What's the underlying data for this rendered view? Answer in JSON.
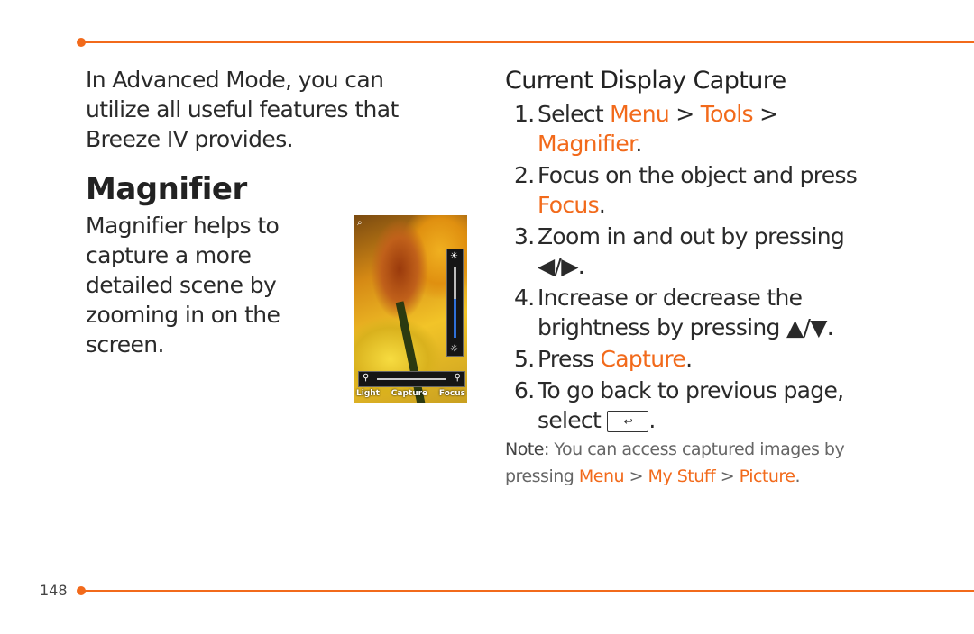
{
  "colors": {
    "accent": "#f26a1b",
    "text": "#2a2a2a"
  },
  "intro": "In Advanced Mode, you can utilize all useful features that Breeze IV provides.",
  "magnifier": {
    "title": "Magnifier",
    "description": "Magnifier helps to capture a more detailed scene by zooming in on the screen.",
    "screen": {
      "softkeys": {
        "left": "Light",
        "center": "Capture",
        "right": "Focus"
      },
      "icons": {
        "top_left": "magnifier-mode-icon",
        "brightness_high": "sun-icon",
        "brightness_low": "sun-outline-icon",
        "zoom_out": "zoom-out-icon",
        "zoom_in": "zoom-in-icon"
      },
      "brightness_level": 0.55
    }
  },
  "section": {
    "title": "Current Display Capture",
    "steps": [
      {
        "num": "1.",
        "text": "Select ",
        "path": [
          "Menu",
          "Tools",
          "Magnifier"
        ],
        "end": "."
      },
      {
        "num": "2.",
        "text": "Focus on the object and press ",
        "highlight": "Focus",
        "end": "."
      },
      {
        "num": "3.",
        "text": "Zoom in and out by pressing ",
        "keys": "◀/▶",
        "end": "."
      },
      {
        "num": "4.",
        "text": "Increase or decrease the brightness by pressing ",
        "keys": "▲/▼",
        "end": "."
      },
      {
        "num": "5.",
        "text": "Press ",
        "highlight": "Capture",
        "end": "."
      },
      {
        "num": "6.",
        "text": "To go back to previous page, select ",
        "key_icon": "↩",
        "end": "."
      }
    ],
    "note": {
      "label": "Note:",
      "text": " You can access captured images by pressing ",
      "path": [
        "Menu",
        "My Stuff",
        "Picture"
      ],
      "end": "."
    }
  },
  "page_number": "148"
}
